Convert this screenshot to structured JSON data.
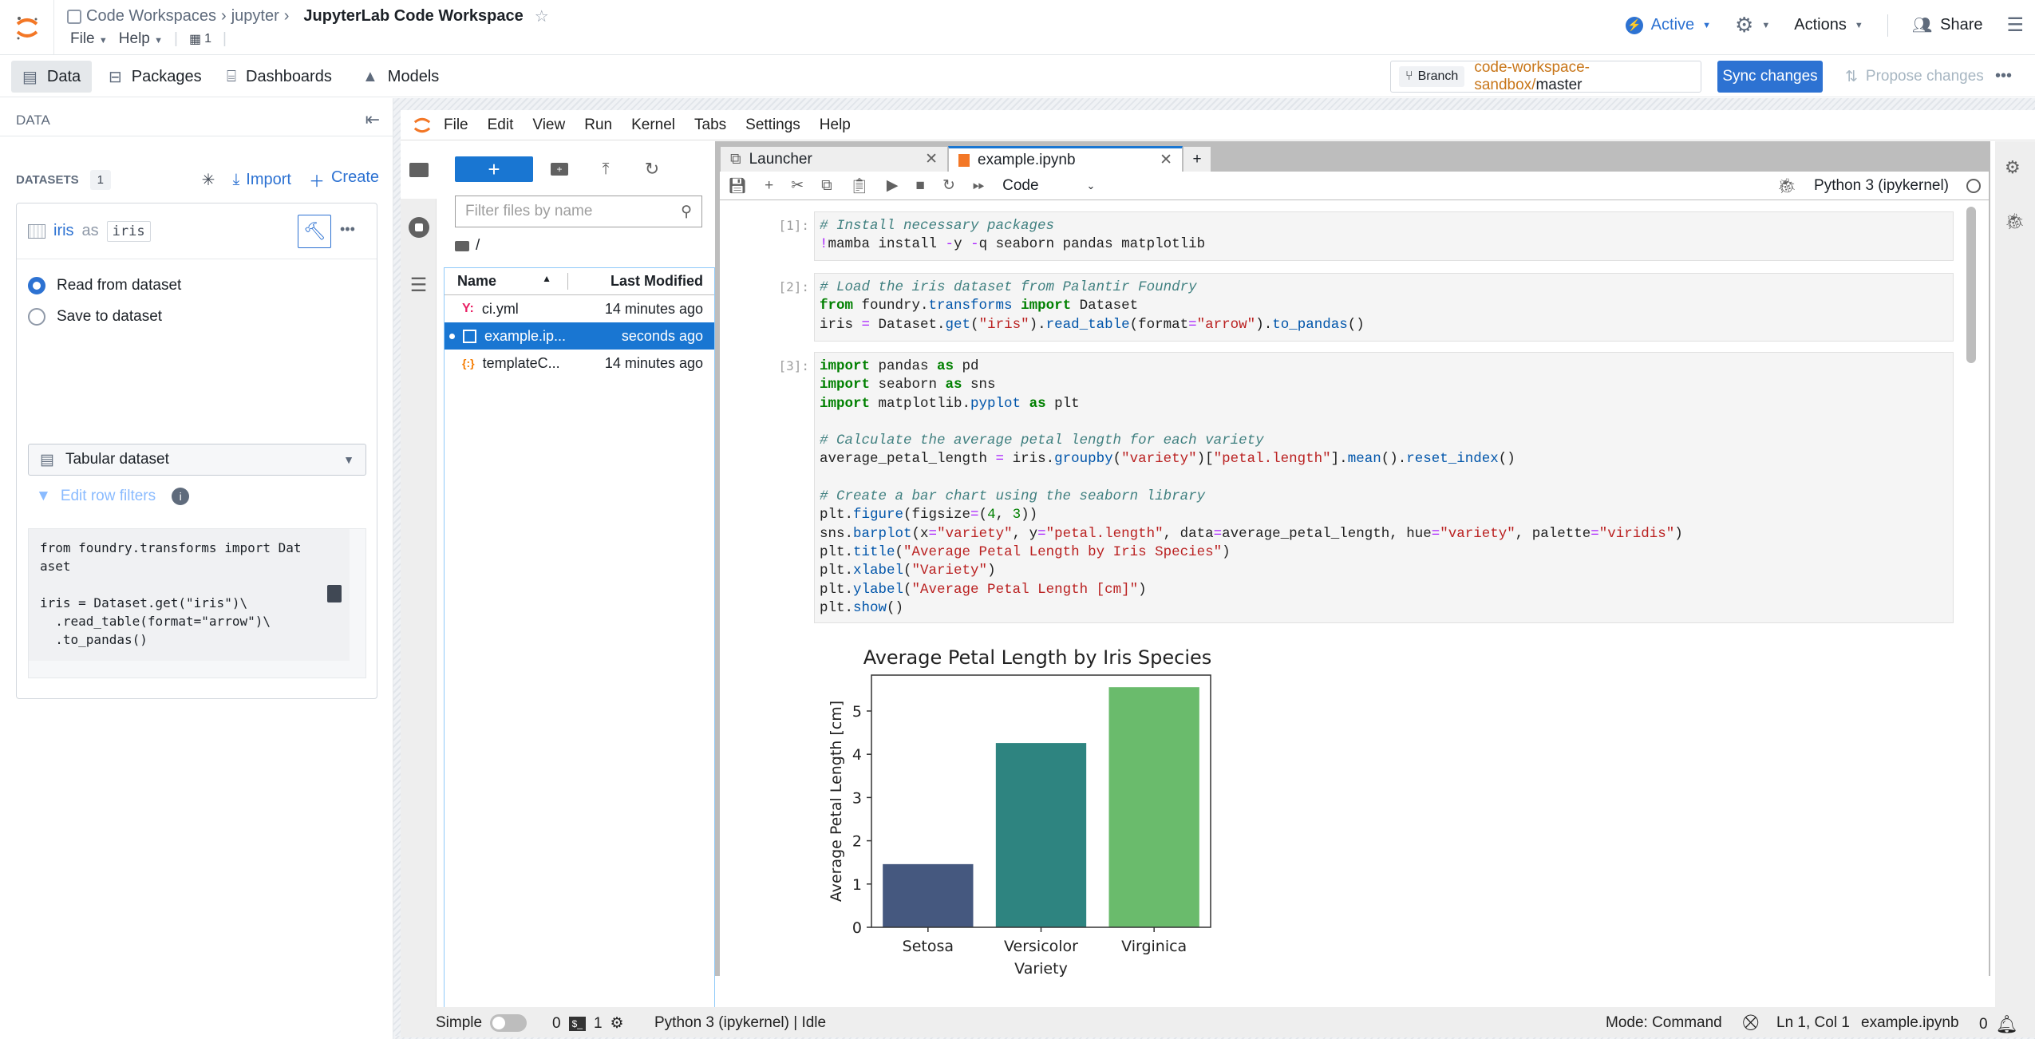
{
  "header": {
    "breadcrumb": [
      "Code Workspaces",
      "jupyter"
    ],
    "title": "JupyterLab Code Workspace",
    "menu": [
      {
        "label": "File"
      },
      {
        "label": "Help"
      }
    ],
    "branch_count": "1",
    "status": "Active",
    "actions_label": "Actions",
    "share_label": "Share"
  },
  "nav": {
    "tabs": [
      {
        "label": "Data"
      },
      {
        "label": "Packages"
      },
      {
        "label": "Dashboards"
      },
      {
        "label": "Models"
      }
    ],
    "branch_tag": "Branch",
    "branch_prefix": "code-workspace-sandbox/",
    "branch_name": "master",
    "sync_label": "Sync changes",
    "propose_label": "Propose changes"
  },
  "data_panel": {
    "title": "DATA",
    "datasets_label": "DATASETS",
    "datasets_count": "1",
    "import_label": "Import",
    "create_label": "Create",
    "dataset": {
      "name": "iris",
      "as": "as",
      "alias": "iris",
      "options": [
        {
          "label": "Read from dataset",
          "checked": true
        },
        {
          "label": "Save to dataset",
          "checked": false
        }
      ],
      "type_select": "Tabular dataset",
      "row_filters_label": "Edit row filters",
      "snippet": "from foundry.transforms import Dat\naset\n\niris = Dataset.get(\"iris\")\\\n  .read_table(format=\"arrow\")\\\n  .to_pandas()"
    }
  },
  "jupyter": {
    "menu": [
      "File",
      "Edit",
      "View",
      "Run",
      "Kernel",
      "Tabs",
      "Settings",
      "Help"
    ],
    "filebrowser": {
      "filter_placeholder": "Filter files by name",
      "path": "/",
      "col_name": "Name",
      "col_modified": "Last Modified",
      "files": [
        {
          "name": "ci.yml",
          "modified": "14 minutes ago",
          "icon": "yaml-icon",
          "selected": false
        },
        {
          "name": "example.ip...",
          "modified": "seconds ago",
          "icon": "notebook-icon",
          "selected": true
        },
        {
          "name": "templateC...",
          "modified": "14 minutes ago",
          "icon": "json-icon",
          "selected": false
        }
      ]
    },
    "tabs": [
      {
        "label": "Launcher",
        "active": false
      },
      {
        "label": "example.ipynb",
        "active": true
      }
    ],
    "cell_type": "Code",
    "kernel": "Python 3 (ipykernel)",
    "cells": [
      {
        "prompt": "[1]:"
      },
      {
        "prompt": "[2]:"
      },
      {
        "prompt": "[3]:"
      }
    ]
  },
  "status_bar": {
    "simple_label": "Simple",
    "count_a": "0",
    "count_b": "1",
    "kernel_status": "Python 3 (ipykernel) | Idle",
    "mode": "Mode: Command",
    "position": "Ln 1, Col 1",
    "file": "example.ipynb",
    "notifications": "0"
  },
  "chart_data": {
    "type": "bar",
    "title": "Average Petal Length by Iris Species",
    "xlabel": "Variety",
    "ylabel": "Average Petal Length [cm]",
    "categories": [
      "Setosa",
      "Versicolor",
      "Virginica"
    ],
    "values": [
      1.46,
      4.26,
      5.55
    ],
    "colors": [
      "#45587f",
      "#2e8480",
      "#6abb6c"
    ],
    "ylim": [
      0,
      5.83
    ],
    "yticks": [
      0,
      1,
      2,
      3,
      4,
      5
    ],
    "grid": false,
    "legend": "none"
  }
}
